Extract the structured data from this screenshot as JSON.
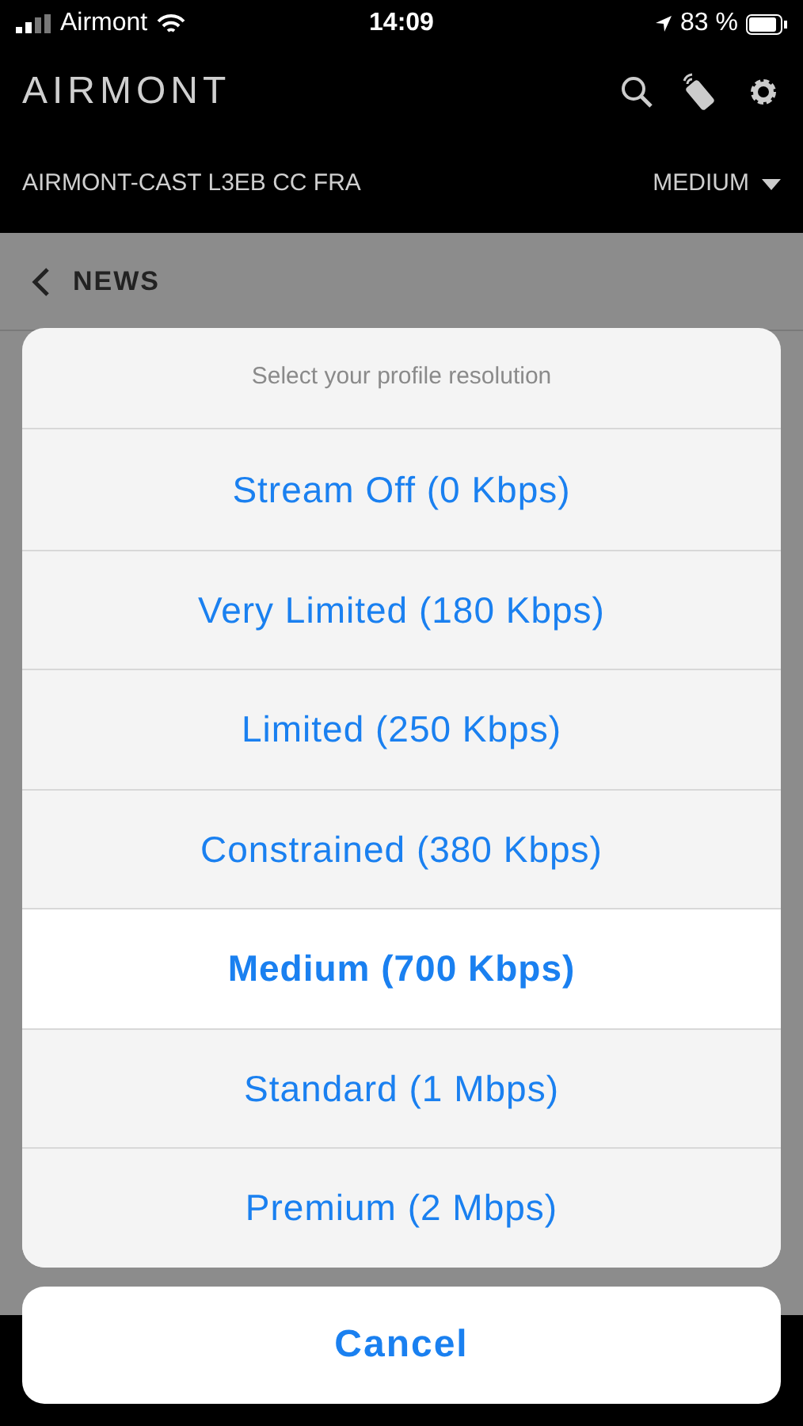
{
  "status_bar": {
    "carrier": "Airmont",
    "time": "14:09",
    "battery": "83 %"
  },
  "header": {
    "logo": "AIRMONT"
  },
  "device_bar": {
    "device": "AIRMONT-CAST L3EB CC FRA",
    "profile": "MEDIUM"
  },
  "nav": {
    "back_label": "NEWS"
  },
  "action_sheet": {
    "title": "Select your profile resolution",
    "options": [
      {
        "label": "Stream Off (0 Kbps)",
        "selected": false
      },
      {
        "label": "Very Limited (180 Kbps)",
        "selected": false
      },
      {
        "label": "Limited (250 Kbps)",
        "selected": false
      },
      {
        "label": "Constrained (380 Kbps)",
        "selected": false
      },
      {
        "label": "Medium (700 Kbps)",
        "selected": true
      },
      {
        "label": "Standard (1 Mbps)",
        "selected": false
      },
      {
        "label": "Premium (2 Mbps)",
        "selected": false
      }
    ],
    "cancel": "Cancel"
  }
}
